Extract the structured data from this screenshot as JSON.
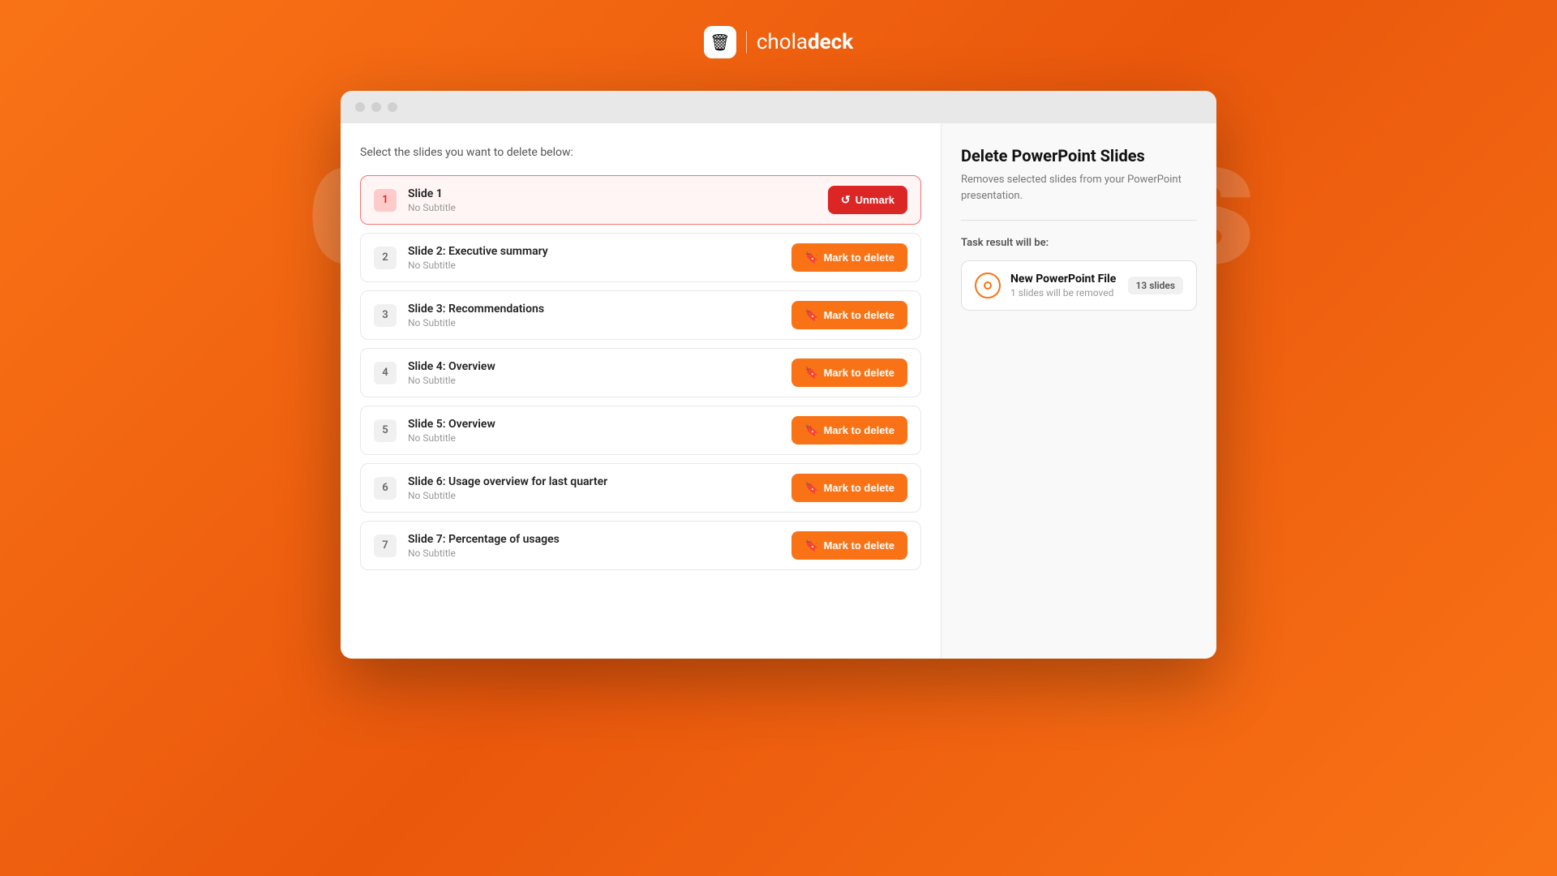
{
  "brand": {
    "logo_emoji": "🗑",
    "name_light": "chola",
    "name_bold": "deck"
  },
  "watermark": {
    "text": "delete slides"
  },
  "window": {
    "dots": [
      "dot1",
      "dot2",
      "dot3"
    ]
  },
  "left_panel": {
    "instruction": "Select the slides you want to delete below:"
  },
  "slides": [
    {
      "number": "1",
      "title": "Slide 1",
      "subtitle": "No Subtitle",
      "marked": true,
      "btn_label": "Unmark"
    },
    {
      "number": "2",
      "title": "Slide 2: Executive summary",
      "subtitle": "No Subtitle",
      "marked": false,
      "btn_label": "Mark to delete"
    },
    {
      "number": "3",
      "title": "Slide 3: Recommendations",
      "subtitle": "No Subtitle",
      "marked": false,
      "btn_label": "Mark to delete"
    },
    {
      "number": "4",
      "title": "Slide 4: Overview",
      "subtitle": "No Subtitle",
      "marked": false,
      "btn_label": "Mark to delete"
    },
    {
      "number": "5",
      "title": "Slide 5: Overview",
      "subtitle": "No Subtitle",
      "marked": false,
      "btn_label": "Mark to delete"
    },
    {
      "number": "6",
      "title": "Slide 6: Usage overview for last quarter",
      "subtitle": "No Subtitle",
      "marked": false,
      "btn_label": "Mark to delete"
    },
    {
      "number": "7",
      "title": "Slide 7: Percentage of usages",
      "subtitle": "No Subtitle",
      "marked": false,
      "btn_label": "Mark to delete"
    }
  ],
  "right_panel": {
    "title": "Delete PowerPoint Slides",
    "description": "Removes selected slides from your PowerPoint presentation.",
    "task_result_label": "Task result will be:",
    "result": {
      "filename": "New PowerPoint File",
      "detail": "1 slides will be removed",
      "badge": "13 slides"
    }
  }
}
